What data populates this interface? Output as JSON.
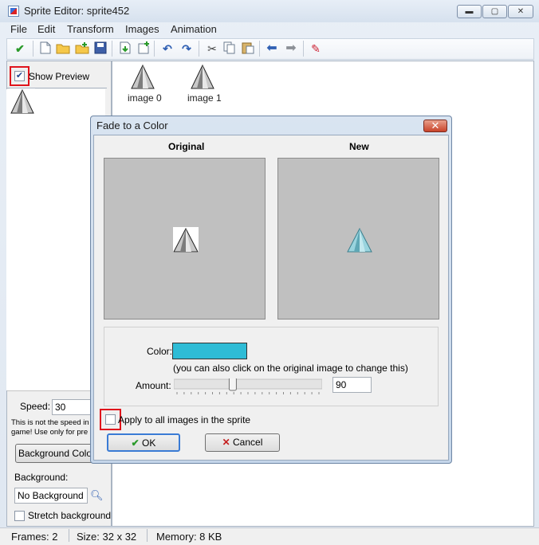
{
  "window": {
    "title": "Sprite Editor: sprite452",
    "caption_buttons": {
      "minimize": "▬",
      "maximize": "▢",
      "close": "✕"
    }
  },
  "menu": [
    "File",
    "Edit",
    "Transform",
    "Images",
    "Animation"
  ],
  "toolbar_icons": [
    "check-icon",
    "new-icon",
    "open-folder-icon",
    "add-folder-icon",
    "save-icon",
    "import-icon",
    "add-image-icon",
    "undo-icon",
    "redo-icon",
    "cut-icon",
    "copy-icon",
    "paste-icon",
    "arrow-left-icon",
    "arrow-right-icon",
    "pencil-icon"
  ],
  "left_panel": {
    "show_preview_label": "Show Preview",
    "show_preview_checked": true,
    "speed_label": "Speed:",
    "speed_value": "30",
    "note_line1": "This is not the speed in",
    "note_line2": "game! Use only for pre",
    "background_color_button": "Background Colo",
    "background_label": "Background:",
    "background_value": "No Background",
    "stretch_label": "Stretch background"
  },
  "images": [
    {
      "label": "image 0"
    },
    {
      "label": "image 1"
    }
  ],
  "dialog": {
    "title": "Fade to a Color",
    "original_label": "Original",
    "new_label": "New",
    "color_label": "Color:",
    "color_value": "#2ebcd6",
    "color_hint": "(you can also click on the original image to change this)",
    "amount_label": "Amount:",
    "amount_value": "90",
    "amount_fraction": 0.39,
    "apply_all_label": "Apply to all images in the sprite",
    "apply_all_checked": false,
    "ok_label": "OK",
    "cancel_label": "Cancel"
  },
  "status": {
    "frames": "Frames: 2",
    "size": "Size: 32 x 32",
    "memory": "Memory: 8 KB"
  },
  "colors": {
    "highlight": "#e0141c",
    "preview_bg": "#c0c0c0"
  }
}
